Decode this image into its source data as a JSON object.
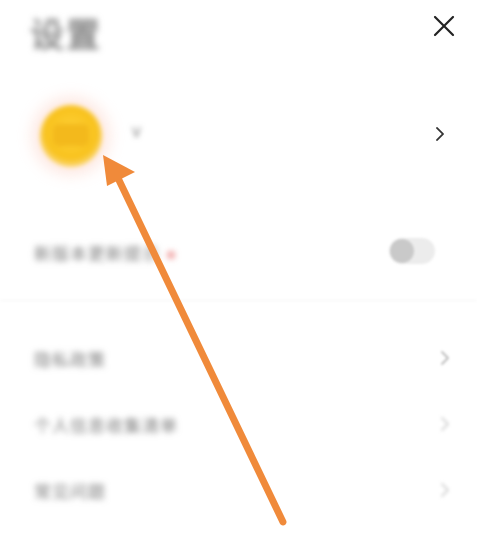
{
  "header": {
    "title": "设置",
    "close_icon": "close-icon"
  },
  "profile": {
    "name": "V",
    "avatar_color": "#f8c21d"
  },
  "settings": {
    "rows": [
      {
        "label": "新版本更新提示",
        "has_dot": true,
        "control": "toggle",
        "toggle_on": false
      },
      {
        "label": "隐私政策",
        "control": "chevron"
      },
      {
        "label": "个人信息收集清单",
        "control": "chevron"
      },
      {
        "label": "常见问题",
        "control": "chevron"
      }
    ]
  },
  "annotation": {
    "arrow_color": "#f08a3a"
  }
}
